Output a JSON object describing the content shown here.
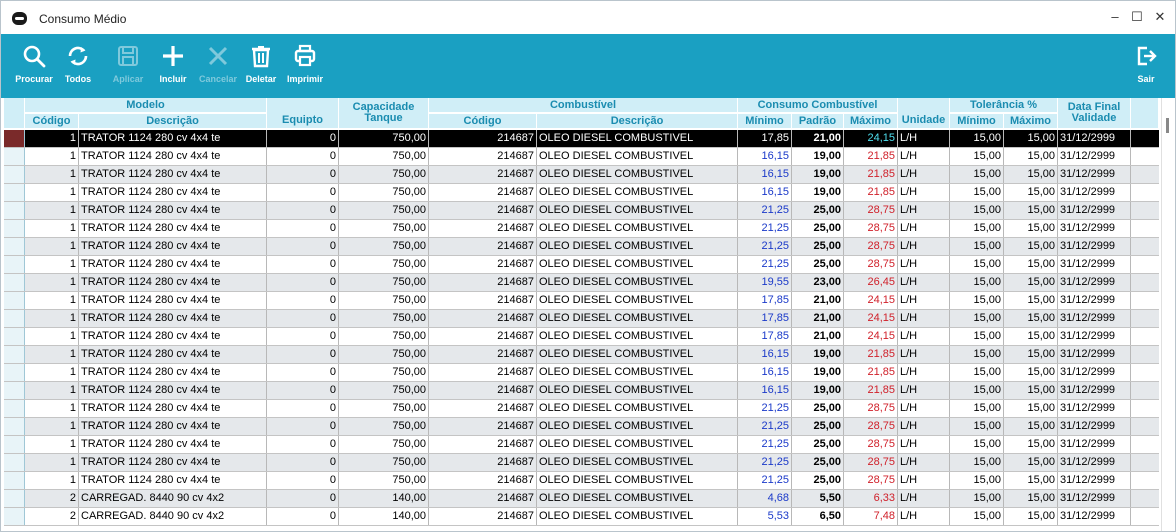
{
  "window": {
    "title": "Consumo Médio"
  },
  "toolbar": {
    "buttons": [
      {
        "label": "Procurar",
        "icon": "search-icon"
      },
      {
        "label": "Todos",
        "icon": "refresh-icon"
      },
      {
        "label": "Aplicar",
        "icon": "save-icon",
        "disabled": true
      },
      {
        "label": "Incluir",
        "icon": "plus-icon"
      },
      {
        "label": "Cancelar",
        "icon": "close-icon",
        "disabled": true
      },
      {
        "label": "Deletar",
        "icon": "trash-icon"
      },
      {
        "label": "Imprimir",
        "icon": "printer-icon"
      }
    ],
    "exit_label": "Sair"
  },
  "grid": {
    "groups": {
      "modelo": "Modelo",
      "combustivel": "Combustível",
      "consumo": "Consumo Combustível",
      "tolerancia": "Tolerância %"
    },
    "headers": {
      "codigo": "Código",
      "descricao": "Descrição",
      "equipto": "Equipto",
      "capacidade_l1": "Capacidade",
      "capacidade_l2": "Tanque",
      "comb_codigo": "Código",
      "comb_descricao": "Descrição",
      "minimo": "Mínimo",
      "padrao": "Padrão",
      "maximo": "Máximo",
      "unidade": "Unidade",
      "tol_minimo": "Mínimo",
      "tol_maximo": "Máximo",
      "data_l1": "Data Final",
      "data_l2": "Validade"
    },
    "rows": [
      [
        "1",
        "TRATOR 1124 280 cv 4x4 te",
        "0",
        "750,00",
        "214687",
        "OLEO DIESEL COMBUSTIVEL",
        "17,85",
        "21,00",
        "24,15",
        "L/H",
        "15,00",
        "15,00",
        "31/12/2999"
      ],
      [
        "1",
        "TRATOR 1124 280 cv 4x4 te",
        "0",
        "750,00",
        "214687",
        "OLEO DIESEL COMBUSTIVEL",
        "16,15",
        "19,00",
        "21,85",
        "L/H",
        "15,00",
        "15,00",
        "31/12/2999"
      ],
      [
        "1",
        "TRATOR 1124 280 cv 4x4 te",
        "0",
        "750,00",
        "214687",
        "OLEO DIESEL COMBUSTIVEL",
        "16,15",
        "19,00",
        "21,85",
        "L/H",
        "15,00",
        "15,00",
        "31/12/2999"
      ],
      [
        "1",
        "TRATOR 1124 280 cv 4x4 te",
        "0",
        "750,00",
        "214687",
        "OLEO DIESEL COMBUSTIVEL",
        "16,15",
        "19,00",
        "21,85",
        "L/H",
        "15,00",
        "15,00",
        "31/12/2999"
      ],
      [
        "1",
        "TRATOR 1124 280 cv 4x4 te",
        "0",
        "750,00",
        "214687",
        "OLEO DIESEL COMBUSTIVEL",
        "21,25",
        "25,00",
        "28,75",
        "L/H",
        "15,00",
        "15,00",
        "31/12/2999"
      ],
      [
        "1",
        "TRATOR 1124 280 cv 4x4 te",
        "0",
        "750,00",
        "214687",
        "OLEO DIESEL COMBUSTIVEL",
        "21,25",
        "25,00",
        "28,75",
        "L/H",
        "15,00",
        "15,00",
        "31/12/2999"
      ],
      [
        "1",
        "TRATOR 1124 280 cv 4x4 te",
        "0",
        "750,00",
        "214687",
        "OLEO DIESEL COMBUSTIVEL",
        "21,25",
        "25,00",
        "28,75",
        "L/H",
        "15,00",
        "15,00",
        "31/12/2999"
      ],
      [
        "1",
        "TRATOR 1124 280 cv 4x4 te",
        "0",
        "750,00",
        "214687",
        "OLEO DIESEL COMBUSTIVEL",
        "21,25",
        "25,00",
        "28,75",
        "L/H",
        "15,00",
        "15,00",
        "31/12/2999"
      ],
      [
        "1",
        "TRATOR 1124 280 cv 4x4 te",
        "0",
        "750,00",
        "214687",
        "OLEO DIESEL COMBUSTIVEL",
        "19,55",
        "23,00",
        "26,45",
        "L/H",
        "15,00",
        "15,00",
        "31/12/2999"
      ],
      [
        "1",
        "TRATOR 1124 280 cv 4x4 te",
        "0",
        "750,00",
        "214687",
        "OLEO DIESEL COMBUSTIVEL",
        "17,85",
        "21,00",
        "24,15",
        "L/H",
        "15,00",
        "15,00",
        "31/12/2999"
      ],
      [
        "1",
        "TRATOR 1124 280 cv 4x4 te",
        "0",
        "750,00",
        "214687",
        "OLEO DIESEL COMBUSTIVEL",
        "17,85",
        "21,00",
        "24,15",
        "L/H",
        "15,00",
        "15,00",
        "31/12/2999"
      ],
      [
        "1",
        "TRATOR 1124 280 cv 4x4 te",
        "0",
        "750,00",
        "214687",
        "OLEO DIESEL COMBUSTIVEL",
        "17,85",
        "21,00",
        "24,15",
        "L/H",
        "15,00",
        "15,00",
        "31/12/2999"
      ],
      [
        "1",
        "TRATOR 1124 280 cv 4x4 te",
        "0",
        "750,00",
        "214687",
        "OLEO DIESEL COMBUSTIVEL",
        "16,15",
        "19,00",
        "21,85",
        "L/H",
        "15,00",
        "15,00",
        "31/12/2999"
      ],
      [
        "1",
        "TRATOR 1124 280 cv 4x4 te",
        "0",
        "750,00",
        "214687",
        "OLEO DIESEL COMBUSTIVEL",
        "16,15",
        "19,00",
        "21,85",
        "L/H",
        "15,00",
        "15,00",
        "31/12/2999"
      ],
      [
        "1",
        "TRATOR 1124 280 cv 4x4 te",
        "0",
        "750,00",
        "214687",
        "OLEO DIESEL COMBUSTIVEL",
        "16,15",
        "19,00",
        "21,85",
        "L/H",
        "15,00",
        "15,00",
        "31/12/2999"
      ],
      [
        "1",
        "TRATOR 1124 280 cv 4x4 te",
        "0",
        "750,00",
        "214687",
        "OLEO DIESEL COMBUSTIVEL",
        "21,25",
        "25,00",
        "28,75",
        "L/H",
        "15,00",
        "15,00",
        "31/12/2999"
      ],
      [
        "1",
        "TRATOR 1124 280 cv 4x4 te",
        "0",
        "750,00",
        "214687",
        "OLEO DIESEL COMBUSTIVEL",
        "21,25",
        "25,00",
        "28,75",
        "L/H",
        "15,00",
        "15,00",
        "31/12/2999"
      ],
      [
        "1",
        "TRATOR 1124 280 cv 4x4 te",
        "0",
        "750,00",
        "214687",
        "OLEO DIESEL COMBUSTIVEL",
        "21,25",
        "25,00",
        "28,75",
        "L/H",
        "15,00",
        "15,00",
        "31/12/2999"
      ],
      [
        "1",
        "TRATOR 1124 280 cv 4x4 te",
        "0",
        "750,00",
        "214687",
        "OLEO DIESEL COMBUSTIVEL",
        "21,25",
        "25,00",
        "28,75",
        "L/H",
        "15,00",
        "15,00",
        "31/12/2999"
      ],
      [
        "1",
        "TRATOR 1124 280 cv 4x4 te",
        "0",
        "750,00",
        "214687",
        "OLEO DIESEL COMBUSTIVEL",
        "21,25",
        "25,00",
        "28,75",
        "L/H",
        "15,00",
        "15,00",
        "31/12/2999"
      ],
      [
        "2",
        "CARREGAD. 8440 90 cv 4x2",
        "0",
        "140,00",
        "214687",
        "OLEO DIESEL COMBUSTIVEL",
        "4,68",
        "5,50",
        "6,33",
        "L/H",
        "15,00",
        "15,00",
        "31/12/2999"
      ],
      [
        "2",
        "CARREGAD. 8440 90 cv 4x2",
        "0",
        "140,00",
        "214687",
        "OLEO DIESEL COMBUSTIVEL",
        "5,53",
        "6,50",
        "7,48",
        "L/H",
        "15,00",
        "15,00",
        "31/12/2999"
      ]
    ],
    "selected_row": 0
  },
  "colors": {
    "toolbar": "#1aa0c2",
    "header": "#d0eef7",
    "header_text": "#1a8cb0",
    "min_value": "#1a39c9",
    "max_value": "#d0202a"
  }
}
